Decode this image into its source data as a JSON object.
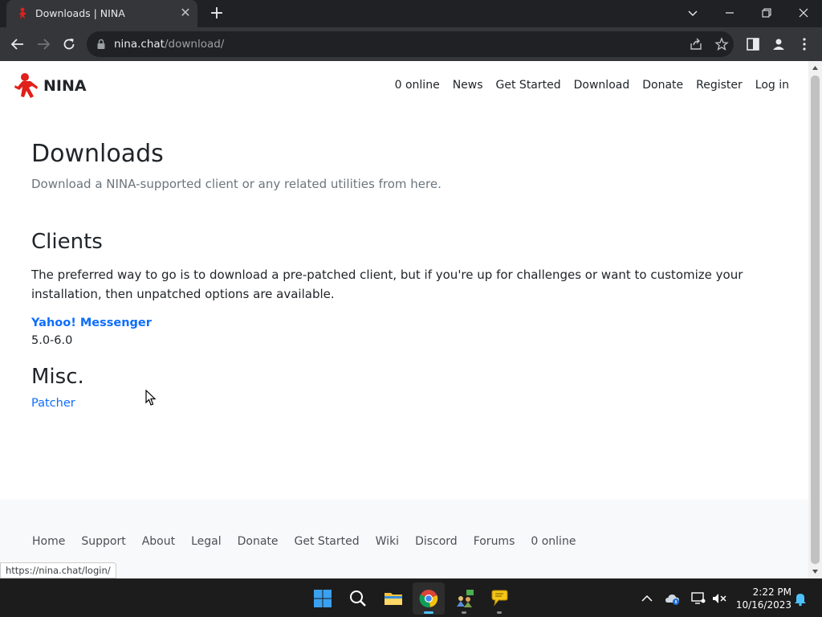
{
  "browser": {
    "tab_title": "Downloads | NINA",
    "url_host": "nina.chat",
    "url_path": "/download/",
    "status_url": "https://nina.chat/login/"
  },
  "site": {
    "brand": "NINA",
    "nav": [
      "0 online",
      "News",
      "Get Started",
      "Download",
      "Donate",
      "Register",
      "Log in"
    ]
  },
  "main": {
    "title": "Downloads",
    "lead": "Download a NINA-supported client or any related utilities from here.",
    "clients_heading": "Clients",
    "clients_text": "The preferred way to go is to download a pre-patched client, but if you're up for challenges or want to customize your installation, then unpatched options are available.",
    "client_link": "Yahoo! Messenger",
    "client_version": "5.0-6.0",
    "misc_heading": "Misc.",
    "misc_link": "Patcher"
  },
  "footer": {
    "links": [
      "Home",
      "Support",
      "About",
      "Legal",
      "Donate",
      "Get Started",
      "Wiki",
      "Discord",
      "Forums",
      "0 online"
    ]
  },
  "taskbar": {
    "time": "2:22 PM",
    "date": "10/16/2023"
  },
  "colors": {
    "link": "#0d6efd",
    "brand_red": "#e0201b",
    "chrome_dark": "#202124"
  }
}
